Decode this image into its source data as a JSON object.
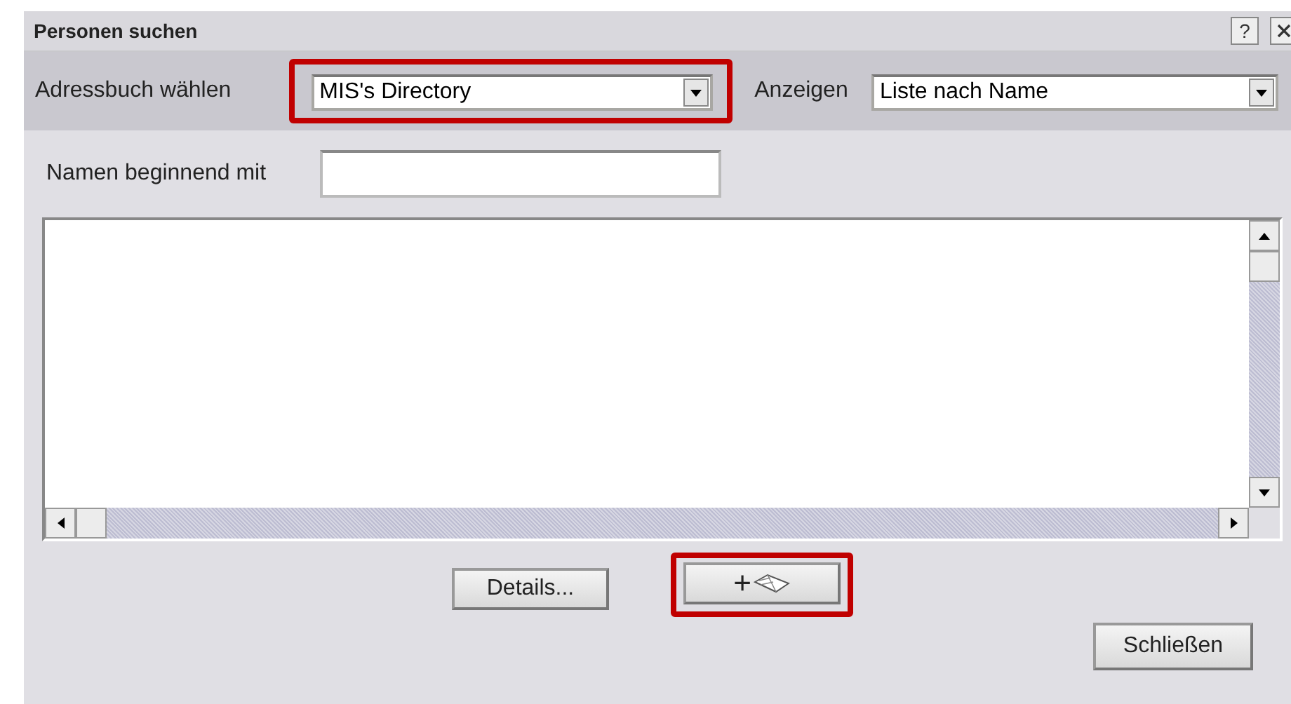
{
  "window": {
    "title": "Personen suchen",
    "help": "?"
  },
  "addressbook": {
    "label": "Adressbuch wählen",
    "value": "MIS's Directory",
    "highlighted": true
  },
  "view": {
    "label": "Anzeigen",
    "value": "Liste nach Name",
    "highlighted": false
  },
  "name_filter": {
    "label": "Namen beginnend mit"
  },
  "buttons": [
    {
      "kind": "text",
      "label": "Details...",
      "highlighted": false
    },
    {
      "kind": "add-book",
      "label": "+",
      "highlighted": true
    }
  ],
  "close_button": {
    "label": "Schließen"
  }
}
